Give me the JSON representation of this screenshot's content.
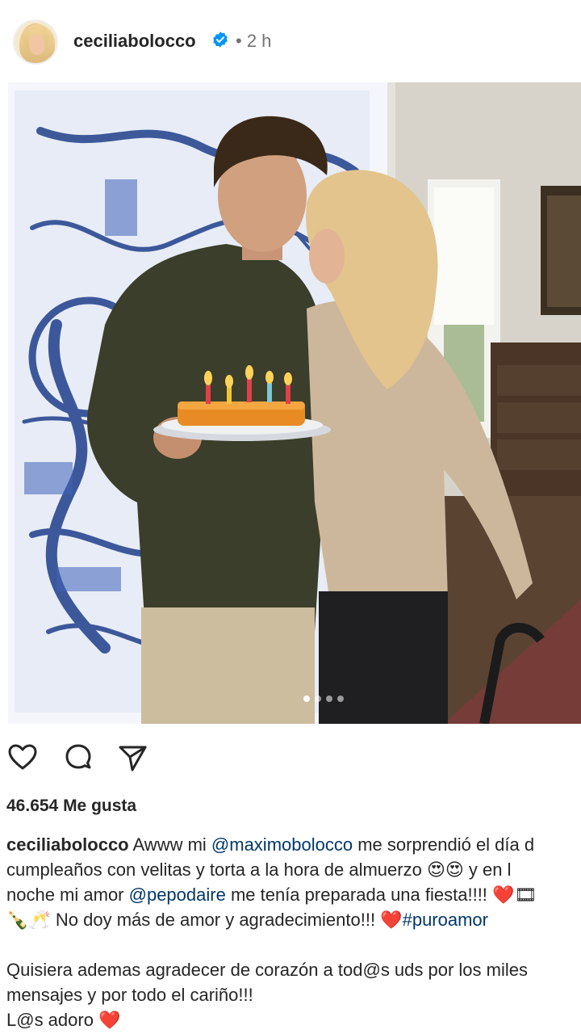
{
  "post": {
    "username": "ceciliabolocco",
    "time_separator": "•",
    "time": "2 h",
    "verified_icon": "verified-badge-icon"
  },
  "carousel": {
    "count": 4,
    "active_index": 0
  },
  "actions": {
    "icons": [
      "heart-icon",
      "comment-icon",
      "share-icon"
    ]
  },
  "likes": {
    "text": "46.654 Me gusta"
  },
  "caption": {
    "username": "ceciliabolocco",
    "line1_a": " Awww mi ",
    "mention1": "@maximobolocco",
    "line1_b": " me sorprendió el día d",
    "line2": "cumpleaños con velitas y torta a la hora de almuerzo 😍😍  y en l",
    "line3_a": "noche mi amor ",
    "mention2": "@pepodaire",
    "line3_b": " me tenía preparada una fiesta!!!! ❤️🎞",
    "line4_a": "🍾🥂  No doy más de amor y agradecimiento!!! ❤️",
    "hashtag": "#puroamor",
    "line5": "Quisiera ademas agradecer de corazón a tod@s uds por los miles",
    "line6": "mensajes y por todo el cariño!!!",
    "line7": "L@s adoro ❤️"
  },
  "colors": {
    "link": "#00376b",
    "verified": "#0095f6",
    "text": "#262626",
    "muted": "#737373"
  }
}
